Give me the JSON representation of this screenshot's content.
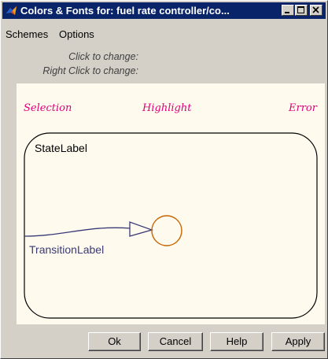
{
  "window": {
    "title": "Colors & Fonts for: fuel rate controller/co..."
  },
  "titlebar_buttons": {
    "minimize_icon": "minimize-icon",
    "maximize_icon": "maximize-icon",
    "close_icon": "close-icon"
  },
  "menu": {
    "items": [
      {
        "label": "Schemes"
      },
      {
        "label": "Options"
      }
    ]
  },
  "hints": {
    "click": "Click to change:",
    "right_click": "Right Click to change:"
  },
  "samples": {
    "selection": "Selection",
    "highlight": "Highlight",
    "error": "Error"
  },
  "diagram": {
    "state_label": "StateLabel",
    "transition_label": "TransitionLabel"
  },
  "buttons": {
    "ok": "Ok",
    "cancel": "Cancel",
    "help": "Help",
    "apply": "Apply"
  },
  "colors": {
    "titlebar": "#0a246a",
    "window_bg": "#d4d0c8",
    "canvas_bg": "#fffaee",
    "sample_text": "#e0007a",
    "transition": "#3a3a78",
    "junction": "#c86400"
  }
}
